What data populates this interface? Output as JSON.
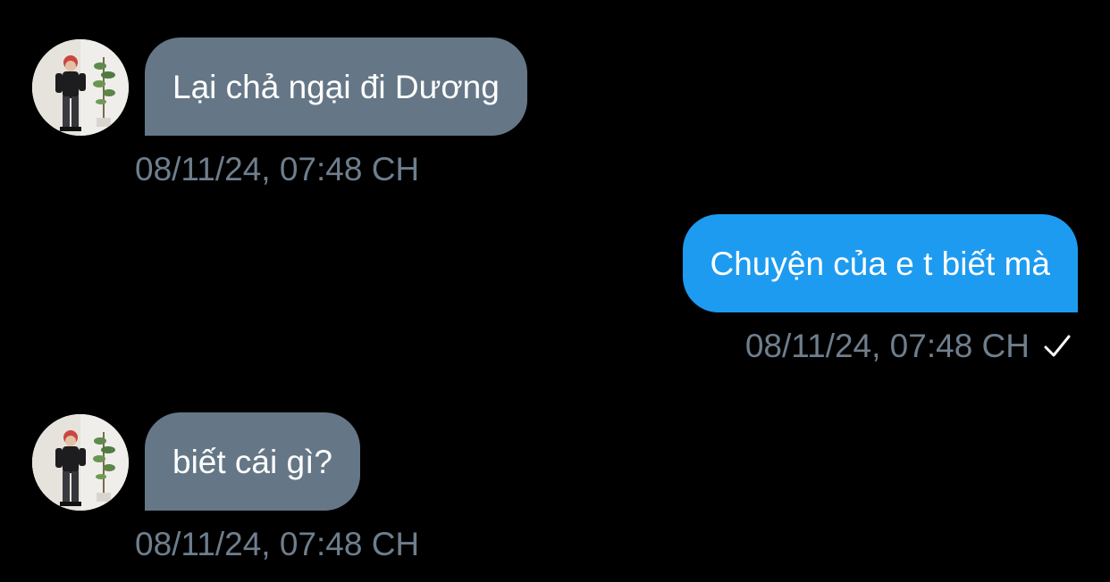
{
  "conversation": {
    "messages": [
      {
        "direction": "incoming",
        "text": "Lại chả ngại đi Dương",
        "timestamp": "08/11/24, 07:48 CH",
        "avatar_icon": "user-avatar"
      },
      {
        "direction": "outgoing",
        "text": "Chuyện của e t biết mà",
        "timestamp": "08/11/24, 07:48 CH",
        "status_icon": "check-icon"
      },
      {
        "direction": "incoming",
        "text": "biết cái gì?",
        "timestamp": "08/11/24, 07:48 CH",
        "avatar_icon": "user-avatar"
      }
    ]
  },
  "colors": {
    "background": "#000000",
    "incoming_bubble": "#657786",
    "outgoing_bubble": "#1d9bf0",
    "timestamp_text": "#6e7e8d",
    "message_text": "#ffffff"
  }
}
